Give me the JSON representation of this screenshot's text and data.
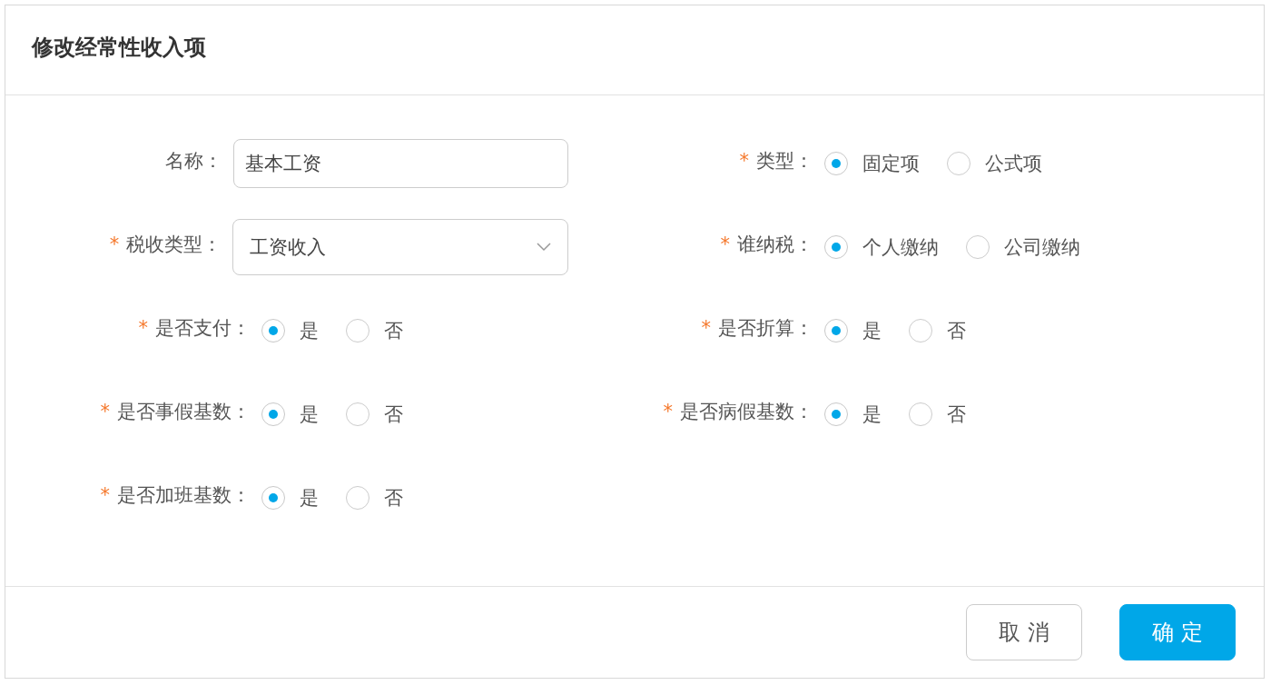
{
  "dialog": {
    "title": "修改经常性收入项"
  },
  "fields": [
    {
      "kind": "input",
      "label": "名称：",
      "value": "基本工资"
    },
    {
      "kind": "radio",
      "required_mark": "*",
      "label": "类型：",
      "options": [
        {
          "label": "固定项",
          "selected": true
        },
        {
          "label": "公式项",
          "selected": false
        }
      ]
    },
    {
      "kind": "select",
      "required_mark": "*",
      "label": "税收类型：",
      "value": "工资收入"
    },
    {
      "kind": "radio",
      "required_mark": "*",
      "label": "谁纳税：",
      "options": [
        {
          "label": "个人缴纳",
          "selected": true
        },
        {
          "label": "公司缴纳",
          "selected": false
        }
      ]
    },
    {
      "kind": "radio",
      "required_mark": "*",
      "label": "是否支付：",
      "options": [
        {
          "label": "是",
          "selected": true
        },
        {
          "label": "否",
          "selected": false
        }
      ]
    },
    {
      "kind": "radio",
      "required_mark": "*",
      "label": "是否折算：",
      "options": [
        {
          "label": "是",
          "selected": true
        },
        {
          "label": "否",
          "selected": false
        }
      ]
    },
    {
      "kind": "radio",
      "required_mark": "*",
      "label": "是否事假基数：",
      "options": [
        {
          "label": "是",
          "selected": true
        },
        {
          "label": "否",
          "selected": false
        }
      ]
    },
    {
      "kind": "radio",
      "required_mark": "*",
      "label": "是否病假基数：",
      "options": [
        {
          "label": "是",
          "selected": true
        },
        {
          "label": "否",
          "selected": false
        }
      ]
    },
    {
      "kind": "radio",
      "required_mark": "*",
      "label": "是否加班基数：",
      "options": [
        {
          "label": "是",
          "selected": true
        },
        {
          "label": "否",
          "selected": false
        }
      ]
    }
  ],
  "buttons": [
    {
      "label": "取 消",
      "kind": "secondary"
    },
    {
      "label": "确 定",
      "kind": "primary"
    }
  ]
}
